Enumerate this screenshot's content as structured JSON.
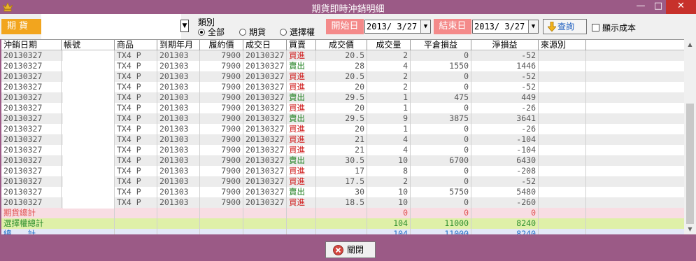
{
  "window": {
    "title": "期貨即時沖銷明細"
  },
  "toolbar": {
    "market": "期貨",
    "type_label": "類別",
    "radios": [
      {
        "label": "全部",
        "selected": true
      },
      {
        "label": "期貨",
        "selected": false
      },
      {
        "label": "選擇權",
        "selected": false
      }
    ],
    "start_label": "開始日",
    "start_date": "2013/ 3/27",
    "end_label": "結束日",
    "end_date": "2013/ 3/27",
    "query_label": "查詢",
    "show_cost_label": "顯示成本"
  },
  "table": {
    "headers": [
      "沖銷日期",
      "帳號",
      "商品",
      "到期年月",
      "履約價",
      "成交日",
      "買賣",
      "成交價",
      "成交量",
      "平倉損益",
      "淨損益",
      "來源別"
    ],
    "rows": [
      [
        "20130327",
        "",
        "TX4 P",
        "201303",
        "7900",
        "20130327",
        "買進",
        "20.5",
        "2",
        "0",
        "-52",
        ""
      ],
      [
        "20130327",
        "",
        "TX4 P",
        "201303",
        "7900",
        "20130327",
        "賣出",
        "28",
        "4",
        "1550",
        "1446",
        ""
      ],
      [
        "20130327",
        "",
        "TX4 P",
        "201303",
        "7900",
        "20130327",
        "買進",
        "20.5",
        "2",
        "0",
        "-52",
        ""
      ],
      [
        "20130327",
        "",
        "TX4 P",
        "201303",
        "7900",
        "20130327",
        "買進",
        "20",
        "2",
        "0",
        "-52",
        ""
      ],
      [
        "20130327",
        "",
        "TX4 P",
        "201303",
        "7900",
        "20130327",
        "賣出",
        "29.5",
        "1",
        "475",
        "449",
        ""
      ],
      [
        "20130327",
        "",
        "TX4 P",
        "201303",
        "7900",
        "20130327",
        "買進",
        "20",
        "1",
        "0",
        "-26",
        ""
      ],
      [
        "20130327",
        "",
        "TX4 P",
        "201303",
        "7900",
        "20130327",
        "賣出",
        "29.5",
        "9",
        "3875",
        "3641",
        ""
      ],
      [
        "20130327",
        "",
        "TX4 P",
        "201303",
        "7900",
        "20130327",
        "買進",
        "20",
        "1",
        "0",
        "-26",
        ""
      ],
      [
        "20130327",
        "",
        "TX4 P",
        "201303",
        "7900",
        "20130327",
        "買進",
        "21",
        "4",
        "0",
        "-104",
        ""
      ],
      [
        "20130327",
        "",
        "TX4 P",
        "201303",
        "7900",
        "20130327",
        "買進",
        "21",
        "4",
        "0",
        "-104",
        ""
      ],
      [
        "20130327",
        "",
        "TX4 P",
        "201303",
        "7900",
        "20130327",
        "賣出",
        "30.5",
        "10",
        "6700",
        "6430",
        ""
      ],
      [
        "20130327",
        "",
        "TX4 P",
        "201303",
        "7900",
        "20130327",
        "買進",
        "17",
        "8",
        "0",
        "-208",
        ""
      ],
      [
        "20130327",
        "",
        "TX4 P",
        "201303",
        "7900",
        "20130327",
        "買進",
        "17.5",
        "2",
        "0",
        "-52",
        ""
      ],
      [
        "20130327",
        "",
        "TX4 P",
        "201303",
        "7900",
        "20130327",
        "賣出",
        "30",
        "10",
        "5750",
        "5480",
        ""
      ],
      [
        "20130327",
        "",
        "TX4 P",
        "201303",
        "7900",
        "20130327",
        "買進",
        "18.5",
        "10",
        "0",
        "-260",
        ""
      ]
    ],
    "summary": [
      {
        "label": "期貨總計",
        "volume": "0",
        "pnl": "0",
        "net": "0"
      },
      {
        "label": "選擇權總計",
        "volume": "104",
        "pnl": "11000",
        "net": "8240"
      },
      {
        "label": "總　　計",
        "volume": "104",
        "pnl": "11000",
        "net": "8240"
      }
    ]
  },
  "footer": {
    "close_label": "關閉"
  },
  "colors": {
    "chrome": "#9b5a86",
    "buy": "#d02020",
    "sell": "#208020",
    "futures_total_bg": "#f8dde3",
    "options_total_bg": "#dff0a8",
    "grand_total_bg": "#e3e8f7"
  }
}
